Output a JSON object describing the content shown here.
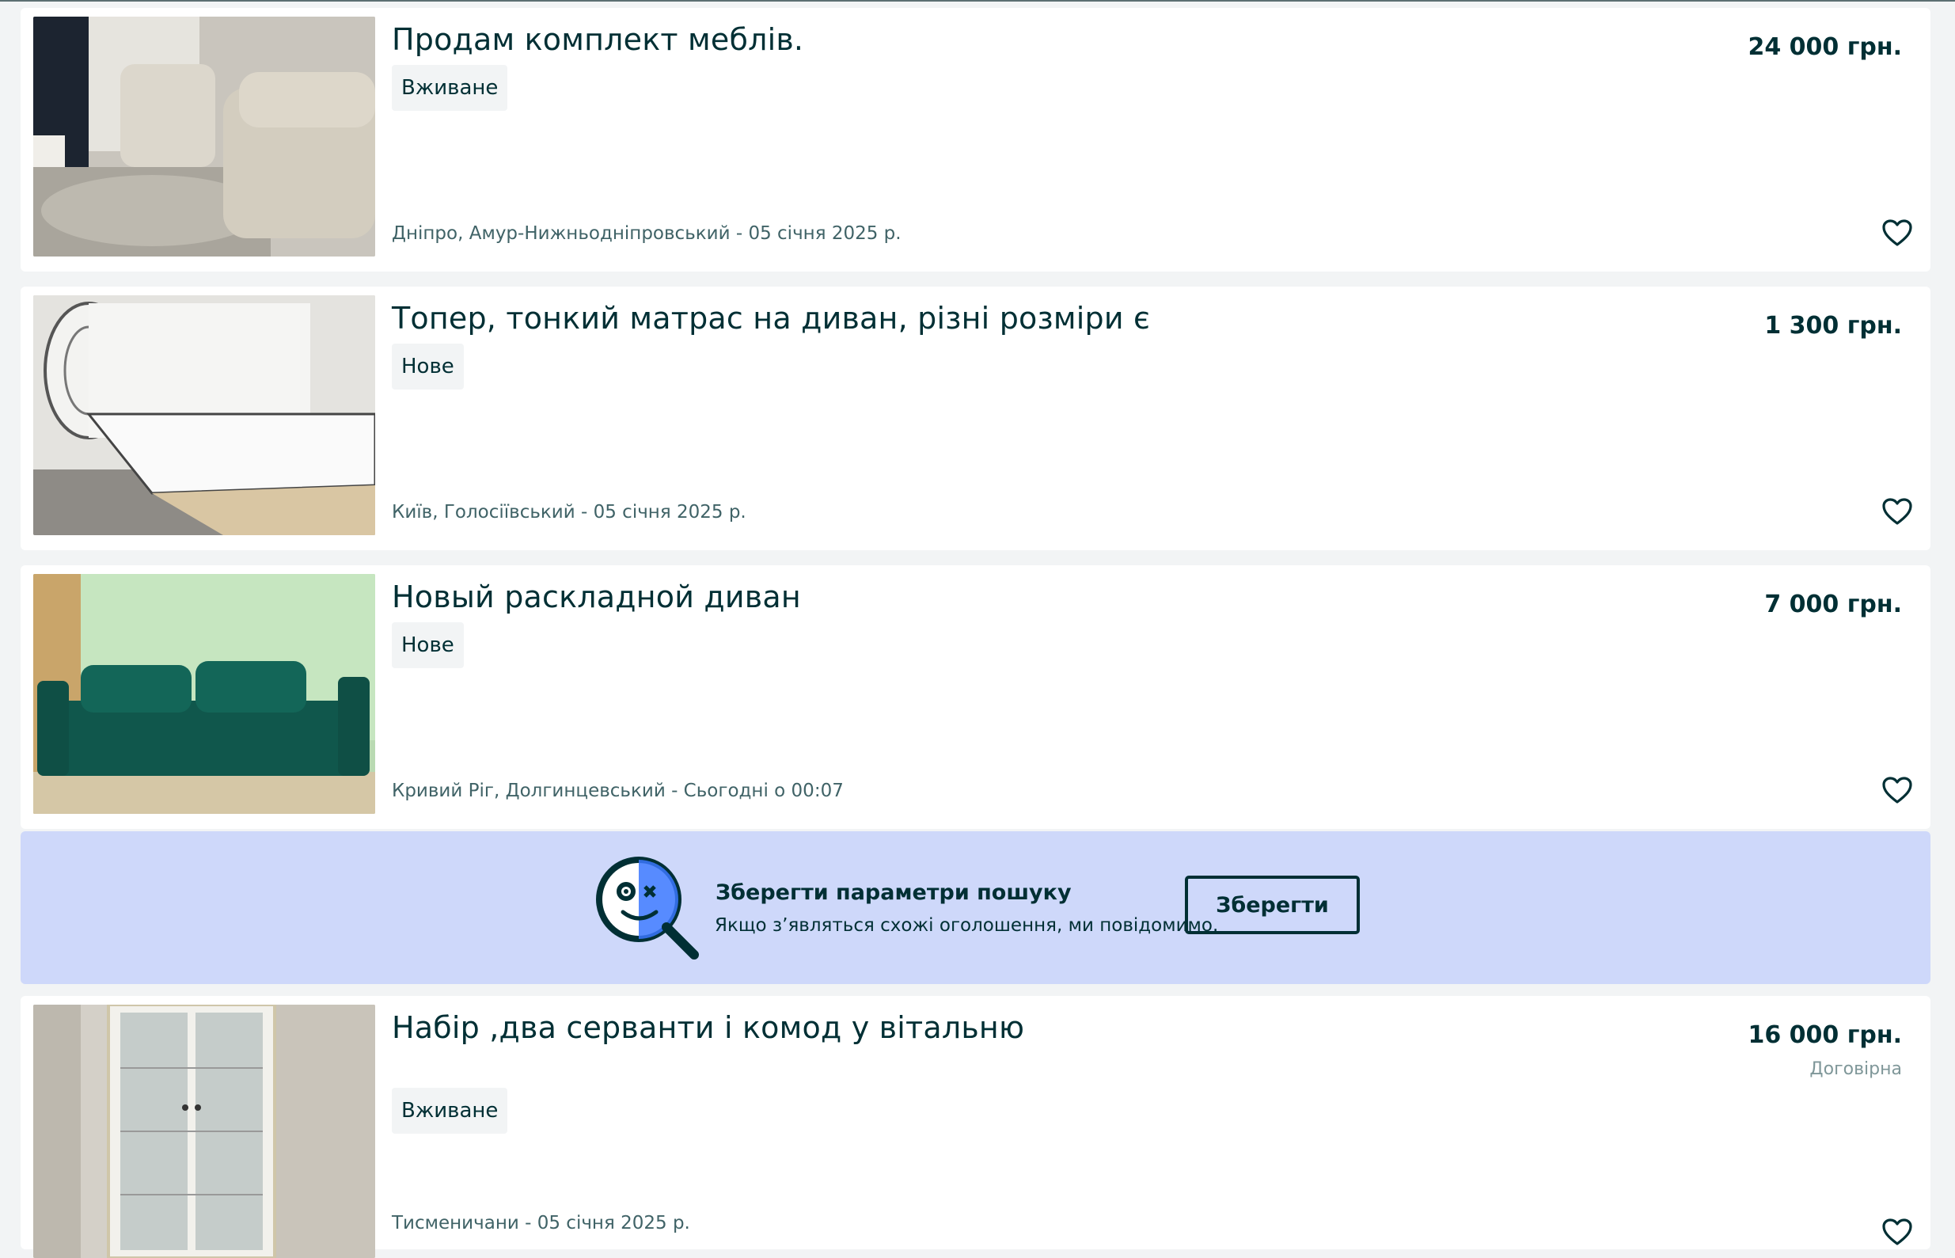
{
  "listings": [
    {
      "title": "Продам комплект меблів.",
      "condition": "Вживане",
      "location": "Дніпро, Амур-Нижньодніпровський - 05 січня 2025 р.",
      "price": "24 000 грн.",
      "negotiable": ""
    },
    {
      "title": "Топер, тонкий матрас на диван, різні розміри є",
      "condition": "Нове",
      "location": "Київ, Голосіївський - 05 січня 2025 р.",
      "price": "1 300 грн.",
      "negotiable": ""
    },
    {
      "title": "Новый раскладной диван",
      "condition": "Нове",
      "location": "Кривий Ріг, Долгинцевський - Сьогодні о 00:07",
      "price": "7 000 грн.",
      "negotiable": ""
    },
    {
      "title": "Набір ,два серванти і комод у вітальню",
      "condition": "Вживане",
      "location": "Тисменичани - 05 січня 2025 р.",
      "price": "16 000 грн.",
      "negotiable": "Договірна"
    }
  ],
  "save_search": {
    "title": "Зберегти параметри пошуку",
    "subtitle": "Якщо з’являться схожі оголошення, ми повідомимо.",
    "button": "Зберегти"
  },
  "icons": {
    "favorite": "heart-outline-icon",
    "search_banner": "magnifier-face-icon"
  },
  "colors": {
    "text": "#002f34",
    "banner_bg": "#ced8fa",
    "page_bg": "#f2f4f5",
    "badge_bg": "#f2f4f5",
    "meta_text": "#406367"
  }
}
